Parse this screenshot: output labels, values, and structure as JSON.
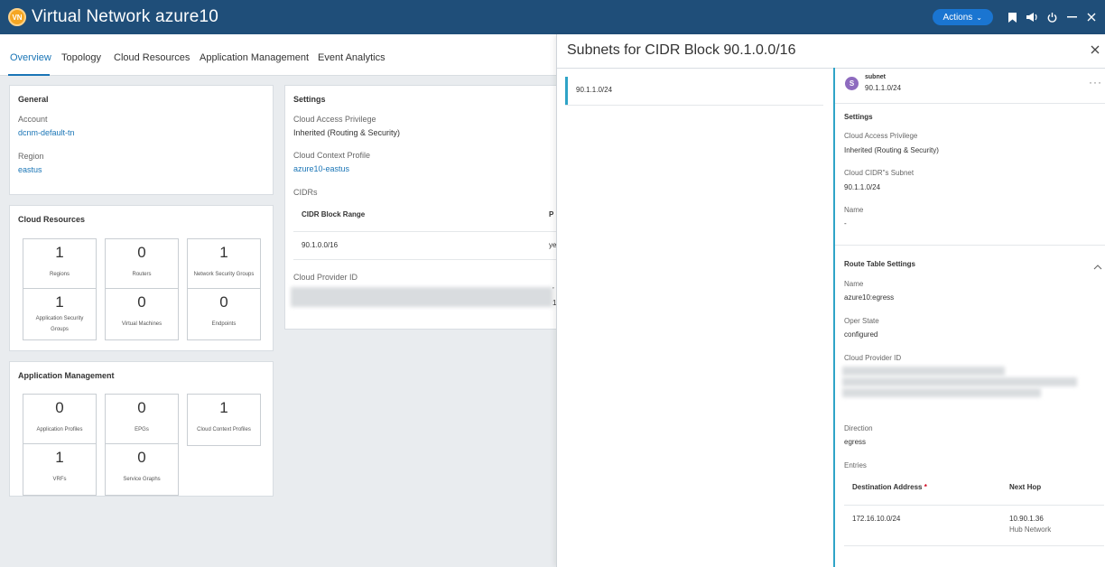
{
  "header": {
    "badge": "VN",
    "title": "Virtual Network azure10",
    "actions_label": "Actions",
    "icons": [
      "bookmark-icon",
      "announcement-icon",
      "power-icon",
      "minimize-icon",
      "close-icon"
    ]
  },
  "tabs": [
    "Overview",
    "Topology",
    "Cloud Resources",
    "Application Management",
    "Event Analytics"
  ],
  "general": {
    "title": "General",
    "account_label": "Account",
    "account_value": "dcnm-default-tn",
    "region_label": "Region",
    "region_value": "eastus"
  },
  "cloud_resources": {
    "title": "Cloud Resources",
    "tiles": [
      {
        "value": "1",
        "label": "Regions"
      },
      {
        "value": "0",
        "label": "Routers"
      },
      {
        "value": "1",
        "label": "Network Security Groups"
      },
      {
        "value": "1",
        "label": "Application Security Groups"
      },
      {
        "value": "0",
        "label": "Virtual Machines"
      },
      {
        "value": "0",
        "label": "Endpoints"
      }
    ]
  },
  "app_mgmt": {
    "title": "Application Management",
    "tiles": [
      {
        "value": "0",
        "label": "Application Profiles"
      },
      {
        "value": "0",
        "label": "EPGs"
      },
      {
        "value": "1",
        "label": "Cloud Context Profiles"
      },
      {
        "value": "1",
        "label": "VRFs"
      },
      {
        "value": "0",
        "label": "Service Graphs"
      }
    ]
  },
  "settings": {
    "title": "Settings",
    "cap_label": "Cloud Access Privilege",
    "cap_value": "Inherited (Routing & Security)",
    "ccp_label": "Cloud Context Profile",
    "ccp_value": "azure10-eastus",
    "cidrs_label": "CIDRs",
    "cidr_col1": "CIDR Block Range",
    "cidr_col2_partial": "P",
    "cidr_row_value": "90.1.0.0/16",
    "cidr_row_partial": "ye",
    "provider_label": "Cloud Provider ID",
    "provider_partial_1": "’",
    "provider_partial_2": "1"
  },
  "panel": {
    "title": "Subnets for CIDR Block 90.1.0.0/16",
    "list_item": "90.1.1.0/24",
    "badge": "S",
    "kind": "subnet",
    "name": "90.1.1.0/24",
    "settings_title": "Settings",
    "cap_label": "Cloud Access Privilege",
    "cap_value": "Inherited (Routing & Security)",
    "cidr_subnet_label": "Cloud CIDR\"s Subnet",
    "cidr_subnet_value": "90.1.1.0/24",
    "name_label": "Name",
    "name_value": "-",
    "rt_title": "Route Table Settings",
    "rt_name_label": "Name",
    "rt_name_value": "azure10:egress",
    "oper_label": "Oper State",
    "oper_value": "configured",
    "provider_label": "Cloud Provider ID",
    "direction_label": "Direction",
    "direction_value": "egress",
    "entries_label": "Entries",
    "entries_col1": "Destination Address",
    "entries_col1_req": "*",
    "entries_col2": "Next Hop",
    "entries": [
      {
        "dest": "172.16.10.0/24",
        "hop": "10.90.1.36",
        "hop_sub": "Hub Network"
      }
    ]
  }
}
